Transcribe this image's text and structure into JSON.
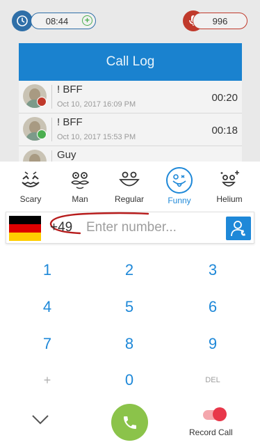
{
  "top_bar": {
    "timer_value": "08:44",
    "credit_value": "996"
  },
  "call_log": {
    "title": "Call Log",
    "rows": [
      {
        "name": "! BFF",
        "date": "Oct 10, 2017 16:09 PM",
        "duration": "00:20",
        "status": "recorded"
      },
      {
        "name": "! BFF",
        "date": "Oct 10, 2017 15:53 PM",
        "duration": "00:18",
        "status": "completed"
      },
      {
        "name": "Guy",
        "date": "",
        "duration": "",
        "status": ""
      }
    ]
  },
  "voices": [
    {
      "label": "Scary",
      "icon": "scary-face-icon"
    },
    {
      "label": "Man",
      "icon": "mustache-face-icon"
    },
    {
      "label": "Regular",
      "icon": "smile-face-icon"
    },
    {
      "label": "Funny",
      "icon": "tongue-face-icon",
      "selected": true
    },
    {
      "label": "Helium",
      "icon": "sparkle-face-icon"
    }
  ],
  "dial": {
    "country_code": "+49",
    "country": "Germany",
    "number_value": "",
    "number_placeholder": "Enter number..."
  },
  "keypad": {
    "k1": "1",
    "k2": "2",
    "k3": "3",
    "k4": "4",
    "k5": "5",
    "k6": "6",
    "k7": "7",
    "k8": "8",
    "k9": "9",
    "kplus": "+",
    "k0": "0",
    "kdel": "DEL"
  },
  "bottom": {
    "record_label": "Record Call",
    "record_enabled": true
  },
  "colors": {
    "accent": "#1e88d8",
    "call_green": "#8bc34a",
    "record_red": "#e8374a"
  }
}
